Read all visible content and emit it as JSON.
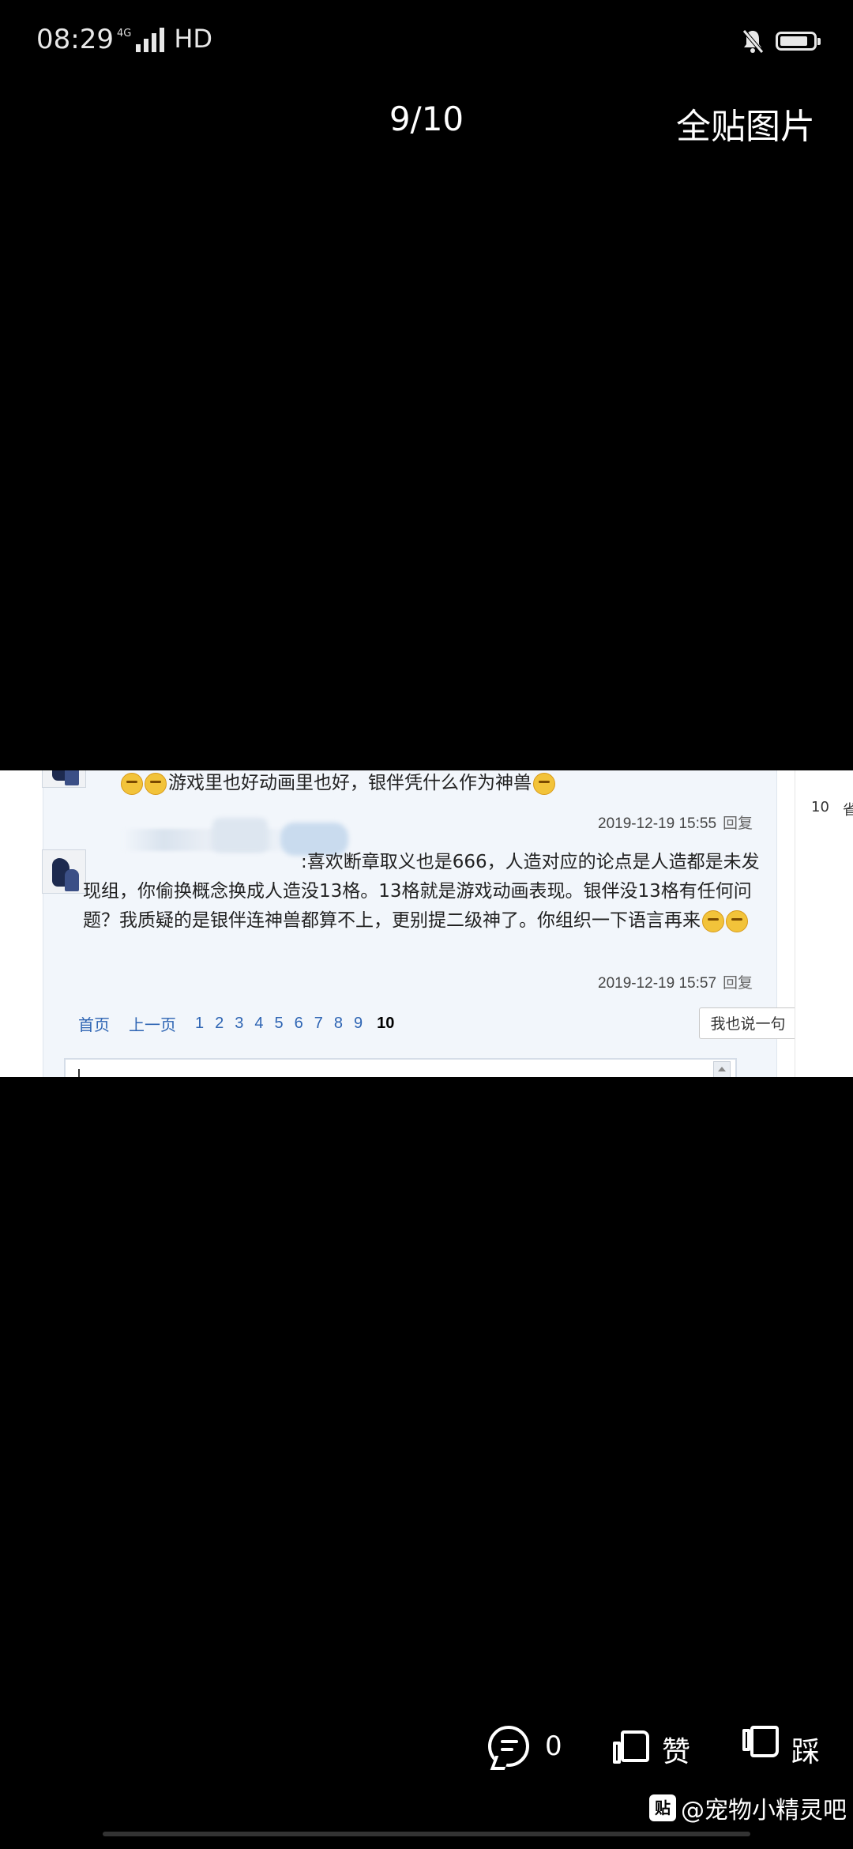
{
  "status_bar": {
    "time": "08:29",
    "network": "4G",
    "hd": "HD"
  },
  "header": {
    "counter": "9/10",
    "all_pictures": "全贴图片"
  },
  "screenshot": {
    "right_strip": {
      "num": "10",
      "text": "省"
    },
    "comment1": {
      "text": "游戏里也好动画里也好，银伴凭什么作为神兽",
      "date": "2019-12-19 15:55",
      "reply": "回复"
    },
    "comment2": {
      "text": ":喜欢断章取义也是666，人造对应的论点是人造都是未发现组，你偷换概念换成人造没13格。13格就是游戏动画表现。银伴没13格有任何问题？我质疑的是银伴连神兽都算不上，更别提二级神了。你组织一下语言再来",
      "date": "2019-12-19 15:57",
      "reply": "回复"
    },
    "pager": {
      "first": "首页",
      "prev": "上一页",
      "pages": [
        "1",
        "2",
        "3",
        "4",
        "5",
        "6",
        "7",
        "8",
        "9"
      ],
      "current": "10"
    },
    "say_button": "我也说一句"
  },
  "bottom_bar": {
    "comment_count": "0",
    "like": "赞",
    "dislike": "踩",
    "watermark": "@宠物小精灵吧",
    "watermark_logo": "贴"
  }
}
